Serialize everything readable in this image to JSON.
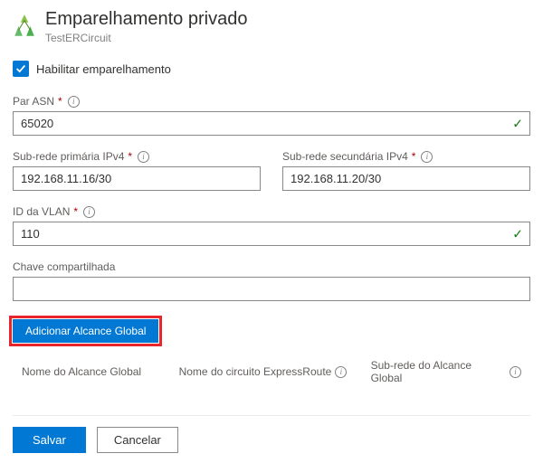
{
  "header": {
    "title": "Emparelhamento privado",
    "subtitle": "TestERCircuit"
  },
  "enable": {
    "label": "Habilitar emparelhamento",
    "checked": true
  },
  "fields": {
    "asn": {
      "label": "Par ASN",
      "required": true,
      "value": "65020",
      "valid": true
    },
    "primary": {
      "label": "Sub-rede primária IPv4",
      "required": true,
      "value": "192.168.11.16/30",
      "valid": false
    },
    "secondary": {
      "label": "Sub-rede secundária IPv4",
      "required": true,
      "value": "192.168.11.20/30",
      "valid": false
    },
    "vlan": {
      "label": "ID da VLAN",
      "required": true,
      "value": "110",
      "valid": true
    },
    "shared": {
      "label": "Chave compartilhada",
      "required": false,
      "value": "",
      "valid": false
    }
  },
  "global_reach": {
    "add_button": "Adicionar Alcance Global",
    "columns": {
      "name": "Nome do Alcance Global",
      "circuit": "Nome do circuito ExpressRoute",
      "subnet": "Sub-rede do Alcance Global"
    }
  },
  "footer": {
    "save": "Salvar",
    "cancel": "Cancelar"
  }
}
